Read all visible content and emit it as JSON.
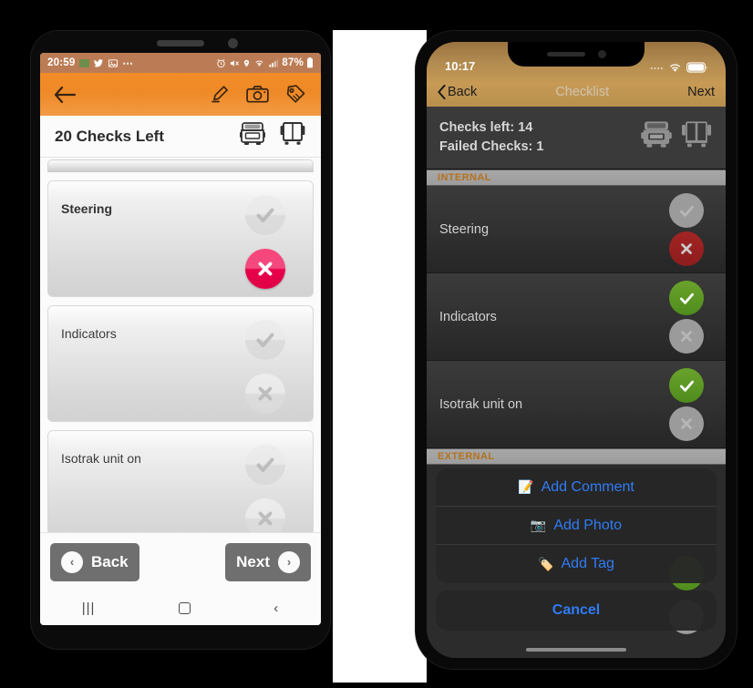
{
  "android": {
    "status_bar": {
      "clock": "20:59",
      "left_icons": [
        "image-badge-icon",
        "twitter-icon",
        "photo-icon",
        "more-icon"
      ],
      "right_icons": [
        "alarm-icon",
        "mute-icon",
        "location-icon",
        "wifi-icon",
        "signal-icon"
      ],
      "battery_text": "87%"
    },
    "appbar": {
      "back_icon": "back-arrow-icon",
      "actions": [
        "pencil-icon",
        "camera-icon",
        "tag-icon"
      ]
    },
    "title_row": {
      "title": "20 Checks Left",
      "icons": [
        "truck-front-icon",
        "trailer-rear-icon"
      ]
    },
    "checks": [
      {
        "label": "Steering",
        "check_state": "off",
        "cross_state": "on"
      },
      {
        "label": "Indicators",
        "check_state": "off",
        "cross_state": "off"
      },
      {
        "label": "Isotrak unit on",
        "check_state": "off",
        "cross_state": "off"
      }
    ],
    "footer": {
      "back_label": "Back",
      "next_label": "Next",
      "back_glyph": "‹",
      "next_glyph": "›"
    },
    "nav_bar": {
      "recents": "|||",
      "home": "home-square-icon",
      "back": "‹"
    }
  },
  "ios": {
    "status_bar": {
      "clock": "10:17",
      "signal_icon": "signal-dots-icon",
      "wifi_icon": "wifi-icon",
      "battery_icon": "battery-icon"
    },
    "nav": {
      "back_label": "Back",
      "back_chevron": "‹",
      "title": "Checklist",
      "next_label": "Next"
    },
    "summary": {
      "checks_left": "Checks left: 14",
      "failed_checks": "Failed Checks: 1",
      "icons": [
        "truck-front-icon",
        "trailer-rear-icon"
      ]
    },
    "sections": [
      {
        "header": "INTERNAL"
      },
      {
        "header": "EXTERNAL"
      }
    ],
    "checks": [
      {
        "label": "Steering",
        "check_state": "off",
        "cross_state": "red"
      },
      {
        "label": "Indicators",
        "check_state": "green",
        "cross_state": "off"
      },
      {
        "label": "Isotrak unit on",
        "check_state": "green",
        "cross_state": "off"
      }
    ],
    "action_sheet": {
      "items": [
        {
          "label": "Add Comment",
          "emoji": "📝"
        },
        {
          "label": "Add Photo",
          "emoji": "📷"
        },
        {
          "label": "Add Tag",
          "emoji": "🏷️"
        }
      ],
      "cancel_label": "Cancel"
    }
  },
  "colors": {
    "android_accent": "#f28c28",
    "android_status": "#bb7c55",
    "ios_gold": "#c79a55",
    "ios_blue": "#2f7cf6",
    "fail_red": "#e8004a",
    "pass_green": "#5d9a23",
    "section_orange": "#b5721f"
  }
}
